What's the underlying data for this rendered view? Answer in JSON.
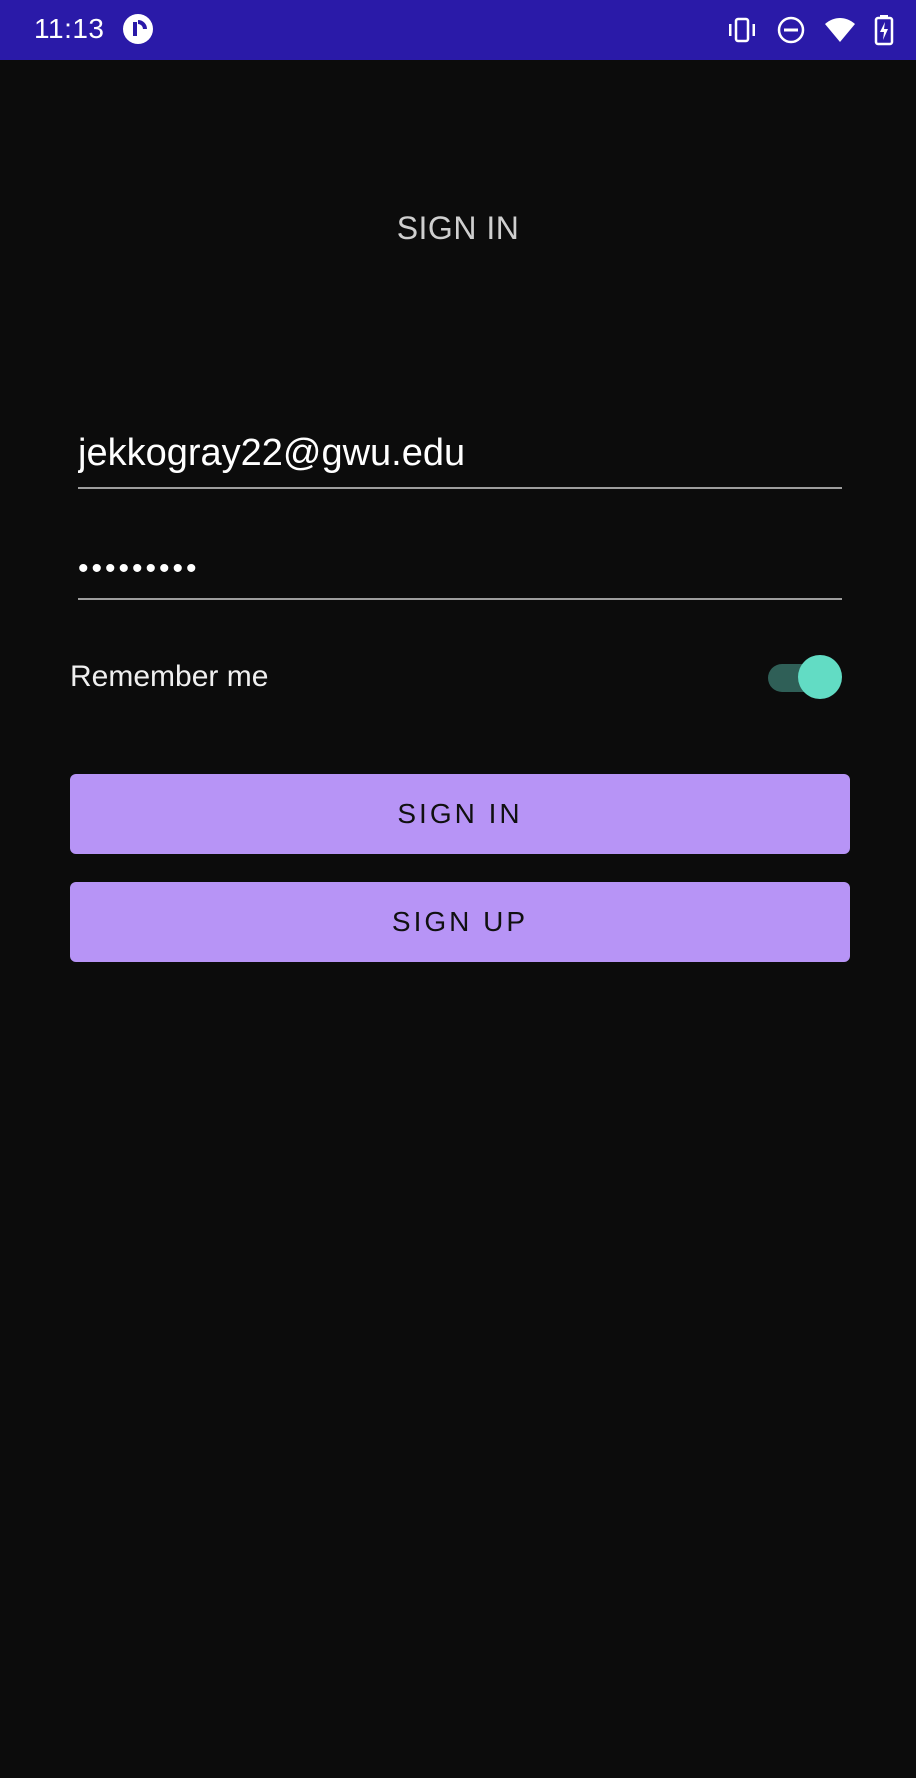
{
  "status_bar": {
    "time": "11:13",
    "app_icon": "pocket-casts-icon",
    "icons": [
      "vibrate-icon",
      "do-not-disturb-icon",
      "wifi-icon",
      "battery-charging-icon"
    ],
    "background_color": "#2a1aa8"
  },
  "screen": {
    "title": "SIGN IN"
  },
  "form": {
    "email_value": "jekkogray22@gwu.edu",
    "password_value": "•••••••••",
    "remember_label": "Remember me",
    "remember_on": true
  },
  "buttons": {
    "sign_in_label": "SIGN IN",
    "sign_up_label": "SIGN UP"
  },
  "colors": {
    "background": "#0c0c0c",
    "button": "#b794f6",
    "toggle_thumb": "#62dcc4",
    "toggle_track": "#2f5f57"
  }
}
